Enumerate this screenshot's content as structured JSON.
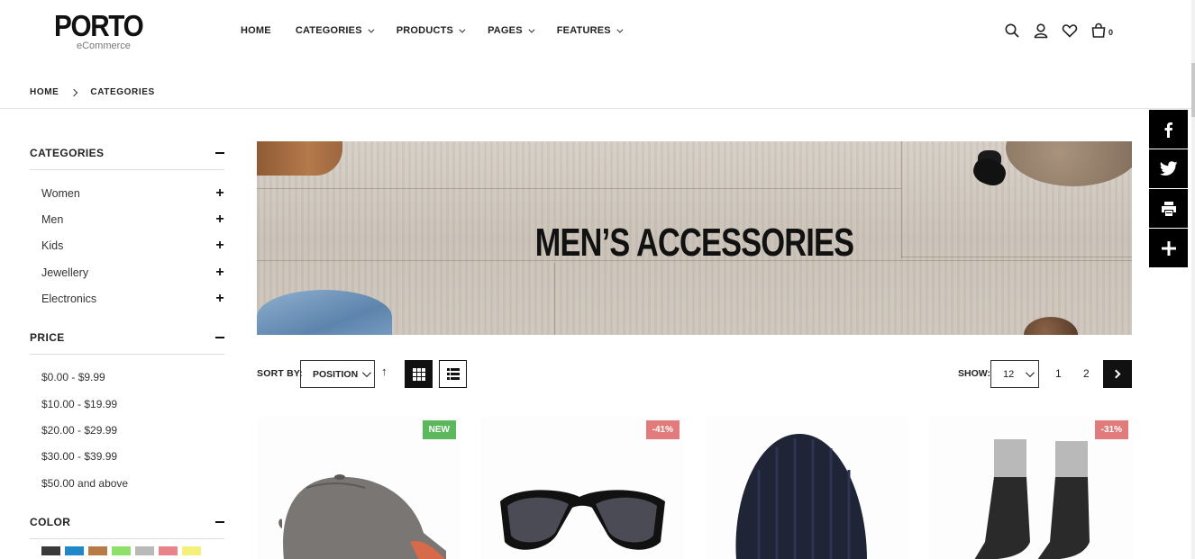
{
  "logo": {
    "name": "PORTO",
    "tagline": "eCommerce"
  },
  "nav": [
    {
      "label": "HOME",
      "dropdown": false
    },
    {
      "label": "CATEGORIES",
      "dropdown": true
    },
    {
      "label": "PRODUCTS",
      "dropdown": true
    },
    {
      "label": "PAGES",
      "dropdown": true
    },
    {
      "label": "FEATURES",
      "dropdown": true
    }
  ],
  "header_icons": [
    "search-icon",
    "user-icon",
    "heart-icon",
    "cart-icon"
  ],
  "cart": {
    "count": "0"
  },
  "breadcrumb": [
    "HOME",
    "CATEGORIES"
  ],
  "sidebar": {
    "categories": {
      "title": "CATEGORIES",
      "items": [
        "Women",
        "Men",
        "Kids",
        "Jewellery",
        "Electronics"
      ]
    },
    "price": {
      "title": "PRICE",
      "items": [
        "$0.00 - $9.99",
        "$10.00 - $19.99",
        "$20.00 - $29.99",
        "$30.00 - $39.99",
        "$50.00 and above"
      ]
    },
    "color": {
      "title": "COLOR",
      "swatches": [
        "#3a3a3a",
        "#1e88c9",
        "#b77c45",
        "#8fe06a",
        "#b9b9b9",
        "#e88389",
        "#f4f07a"
      ]
    }
  },
  "banner": {
    "title": "MEN’S ACCESSORIES"
  },
  "toolbar": {
    "sort_label": "SORT BY:",
    "sort_value": "POSITION",
    "sort_dir_glyph": "↑",
    "show_label": "SHOW:",
    "show_value": "12",
    "pages": [
      "1",
      "2"
    ]
  },
  "products": [
    {
      "name": "cap",
      "badge": "NEW",
      "badge_color": "#5cb85c"
    },
    {
      "name": "sunglasses",
      "badge": "-41%",
      "badge_color": "#e27c7c"
    },
    {
      "name": "beanie",
      "badge": "",
      "badge_color": ""
    },
    {
      "name": "socks",
      "badge": "-31%",
      "badge_color": "#e27c7c"
    }
  ],
  "share": [
    "facebook-icon",
    "twitter-icon",
    "print-icon",
    "plus-icon"
  ],
  "colors": {
    "accent": "#111111",
    "new_badge": "#5cb85c",
    "sale_badge": "#e27c7c"
  }
}
